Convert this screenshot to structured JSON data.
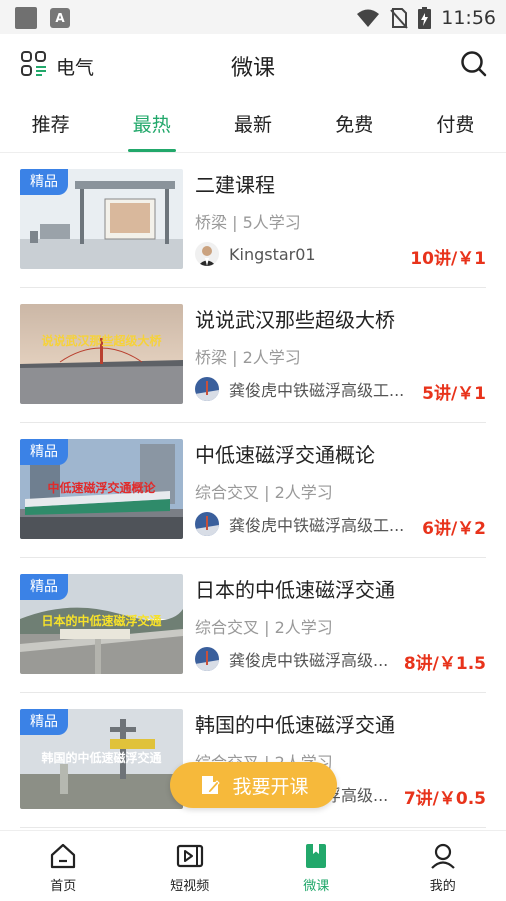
{
  "status_bar": {
    "time": "11:56"
  },
  "header": {
    "category": "电气",
    "title": "微课"
  },
  "tabs": [
    {
      "label": "推荐"
    },
    {
      "label": "最热",
      "active": true
    },
    {
      "label": "最新"
    },
    {
      "label": "免费"
    },
    {
      "label": "付费"
    }
  ],
  "courses": [
    {
      "badge": "精品",
      "title": "二建课程",
      "meta": "桥梁 | 5人学习",
      "author": "Kingstar01",
      "price": "10讲/￥1"
    },
    {
      "badge": "",
      "title": "说说武汉那些超级大桥",
      "thumb_text": "说说武汉那些超级大桥",
      "meta": "桥梁 | 2人学习",
      "author": "龚俊虎中铁磁浮高级工...",
      "price": "5讲/￥1"
    },
    {
      "badge": "精品",
      "title": "中低速磁浮交通概论",
      "thumb_text": "中低速磁浮交通概论",
      "meta": "综合交叉 | 2人学习",
      "author": "龚俊虎中铁磁浮高级工...",
      "price": "6讲/￥2"
    },
    {
      "badge": "精品",
      "title": "日本的中低速磁浮交通",
      "thumb_text": "日本的中低速磁浮交通",
      "meta": "综合交叉 | 2人学习",
      "author": "龚俊虎中铁磁浮高级...",
      "price": "8讲/￥1.5"
    },
    {
      "badge": "精品",
      "title": "韩国的中低速磁浮交通",
      "thumb_text": "韩国的中低速磁浮交通",
      "meta": "综合交叉 | 2人学习",
      "author": "龚俊虎中铁磁浮高级...",
      "price": "7讲/￥0.5"
    }
  ],
  "fab": {
    "label": "我要开课"
  },
  "bottom_nav": [
    {
      "label": "首页",
      "icon": "home-icon"
    },
    {
      "label": "短视频",
      "icon": "video-icon"
    },
    {
      "label": "微课",
      "icon": "bookmark-book-icon",
      "active": true
    },
    {
      "label": "我的",
      "icon": "person-icon"
    }
  ],
  "colors": {
    "accent": "#22a86b",
    "price": "#e8331b",
    "badge": "#3b82e6",
    "fab": "#f6b93b"
  }
}
